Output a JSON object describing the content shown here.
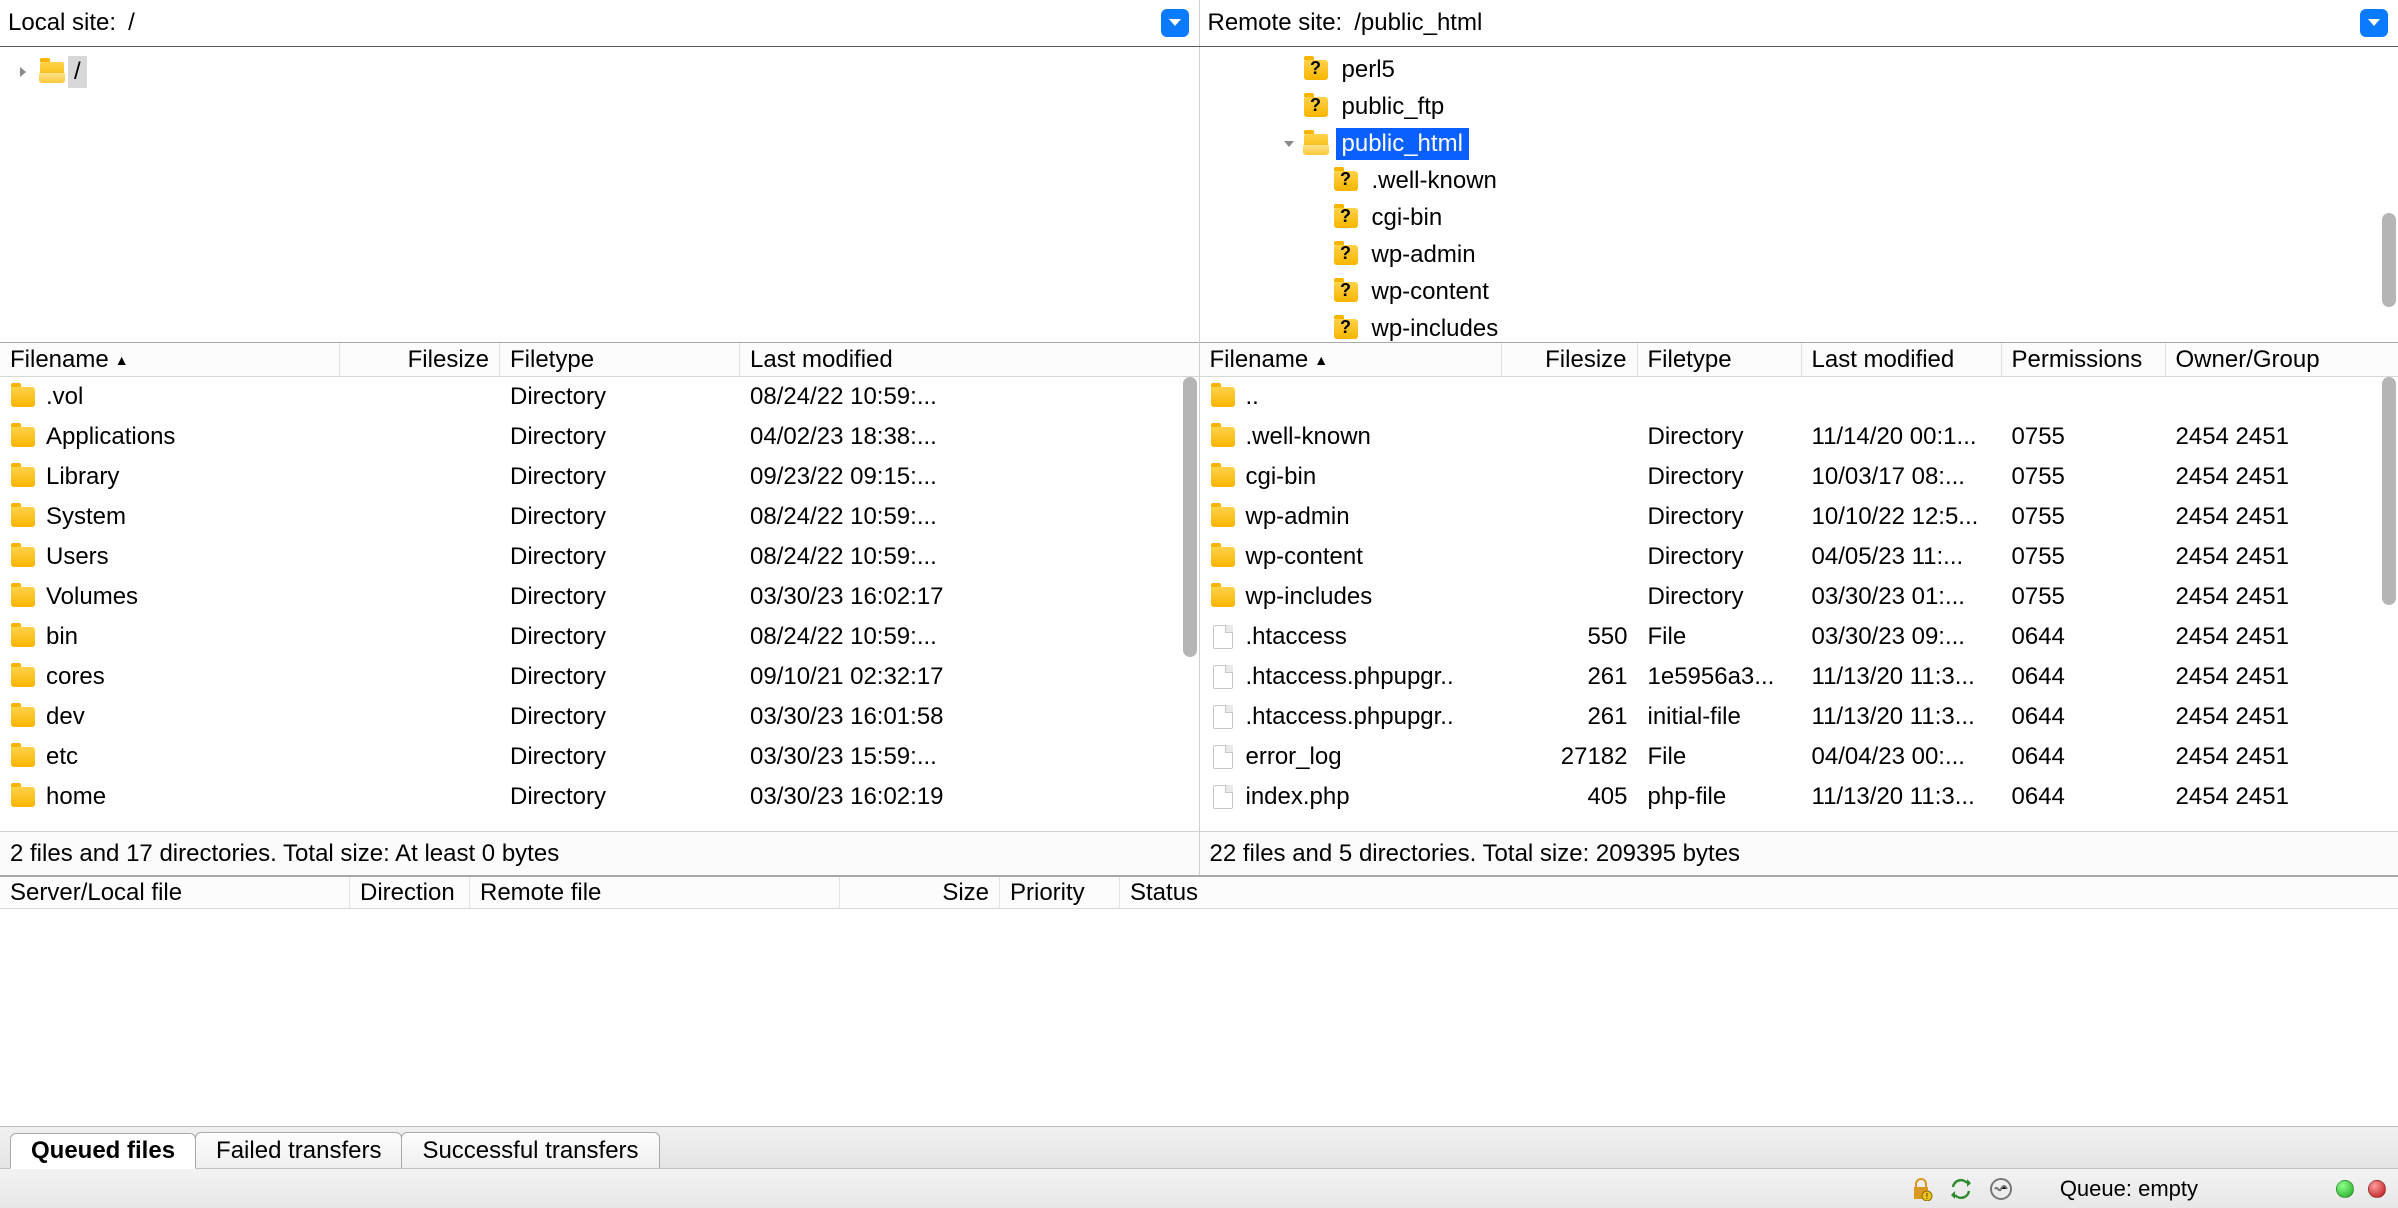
{
  "siteRow": {
    "localLabel": "Local site:",
    "localPath": "/",
    "remoteLabel": "Remote site:",
    "remotePath": "/public_html"
  },
  "localTree": {
    "rootLabel": "/"
  },
  "remoteTree": {
    "items": [
      {
        "label": "perl5",
        "icon": "folder-q",
        "depth": 2,
        "expander": ""
      },
      {
        "label": "public_ftp",
        "icon": "folder-q",
        "depth": 2,
        "expander": ""
      },
      {
        "label": "public_html",
        "icon": "folder-open",
        "depth": 2,
        "expander": "down",
        "selected": true
      },
      {
        "label": ".well-known",
        "icon": "folder-q",
        "depth": 3,
        "expander": ""
      },
      {
        "label": "cgi-bin",
        "icon": "folder-q",
        "depth": 3,
        "expander": ""
      },
      {
        "label": "wp-admin",
        "icon": "folder-q",
        "depth": 3,
        "expander": ""
      },
      {
        "label": "wp-content",
        "icon": "folder-q",
        "depth": 3,
        "expander": ""
      },
      {
        "label": "wp-includes",
        "icon": "folder-q",
        "depth": 3,
        "expander": ""
      }
    ]
  },
  "localList": {
    "headers": {
      "name": "Filename",
      "size": "Filesize",
      "type": "Filetype",
      "mod": "Last modified"
    },
    "sortCaret": "▲",
    "rows": [
      {
        "name": ".vol",
        "size": "",
        "type": "Directory",
        "mod": "08/24/22 10:59:..."
      },
      {
        "name": "Applications",
        "size": "",
        "type": "Directory",
        "mod": "04/02/23 18:38:..."
      },
      {
        "name": "Library",
        "size": "",
        "type": "Directory",
        "mod": "09/23/22 09:15:..."
      },
      {
        "name": "System",
        "size": "",
        "type": "Directory",
        "mod": "08/24/22 10:59:..."
      },
      {
        "name": "Users",
        "size": "",
        "type": "Directory",
        "mod": "08/24/22 10:59:..."
      },
      {
        "name": "Volumes",
        "size": "",
        "type": "Directory",
        "mod": "03/30/23 16:02:17"
      },
      {
        "name": "bin",
        "size": "",
        "type": "Directory",
        "mod": "08/24/22 10:59:..."
      },
      {
        "name": "cores",
        "size": "",
        "type": "Directory",
        "mod": "09/10/21 02:32:17"
      },
      {
        "name": "dev",
        "size": "",
        "type": "Directory",
        "mod": "03/30/23 16:01:58"
      },
      {
        "name": "etc",
        "size": "",
        "type": "Directory",
        "mod": "03/30/23 15:59:..."
      },
      {
        "name": "home",
        "size": "",
        "type": "Directory",
        "mod": "03/30/23 16:02:19"
      }
    ],
    "status": "2 files and 17 directories. Total size: At least 0 bytes"
  },
  "remoteList": {
    "headers": {
      "name": "Filename",
      "size": "Filesize",
      "type": "Filetype",
      "mod": "Last modified",
      "perm": "Permissions",
      "owner": "Owner/Group"
    },
    "sortCaret": "▲",
    "rows": [
      {
        "icon": "folder",
        "name": "..",
        "size": "",
        "type": "",
        "mod": "",
        "perm": "",
        "owner": ""
      },
      {
        "icon": "folder",
        "name": ".well-known",
        "size": "",
        "type": "Directory",
        "mod": "11/14/20 00:1...",
        "perm": "0755",
        "owner": "2454 2451"
      },
      {
        "icon": "folder",
        "name": "cgi-bin",
        "size": "",
        "type": "Directory",
        "mod": "10/03/17 08:...",
        "perm": "0755",
        "owner": "2454 2451"
      },
      {
        "icon": "folder",
        "name": "wp-admin",
        "size": "",
        "type": "Directory",
        "mod": "10/10/22 12:5...",
        "perm": "0755",
        "owner": "2454 2451"
      },
      {
        "icon": "folder",
        "name": "wp-content",
        "size": "",
        "type": "Directory",
        "mod": "04/05/23 11:...",
        "perm": "0755",
        "owner": "2454 2451"
      },
      {
        "icon": "folder",
        "name": "wp-includes",
        "size": "",
        "type": "Directory",
        "mod": "03/30/23 01:...",
        "perm": "0755",
        "owner": "2454 2451"
      },
      {
        "icon": "file",
        "name": ".htaccess",
        "size": "550",
        "type": "File",
        "mod": "03/30/23 09:...",
        "perm": "0644",
        "owner": "2454 2451"
      },
      {
        "icon": "file",
        "name": ".htaccess.phpupgr..",
        "size": "261",
        "type": "1e5956a3...",
        "mod": "11/13/20 11:3...",
        "perm": "0644",
        "owner": "2454 2451"
      },
      {
        "icon": "file",
        "name": ".htaccess.phpupgr..",
        "size": "261",
        "type": "initial-file",
        "mod": "11/13/20 11:3...",
        "perm": "0644",
        "owner": "2454 2451"
      },
      {
        "icon": "file",
        "name": "error_log",
        "size": "27182",
        "type": "File",
        "mod": "04/04/23 00:...",
        "perm": "0644",
        "owner": "2454 2451"
      },
      {
        "icon": "file",
        "name": "index.php",
        "size": "405",
        "type": "php-file",
        "mod": "11/13/20 11:3...",
        "perm": "0644",
        "owner": "2454 2451"
      }
    ],
    "status": "22 files and 5 directories. Total size: 209395 bytes"
  },
  "queueHeaders": {
    "file": "Server/Local file",
    "direction": "Direction",
    "remote": "Remote file",
    "size": "Size",
    "priority": "Priority",
    "status": "Status"
  },
  "tabs": {
    "queued": "Queued files",
    "failed": "Failed transfers",
    "successful": "Successful transfers"
  },
  "statusBar": {
    "queueLabel": "Queue: empty"
  }
}
